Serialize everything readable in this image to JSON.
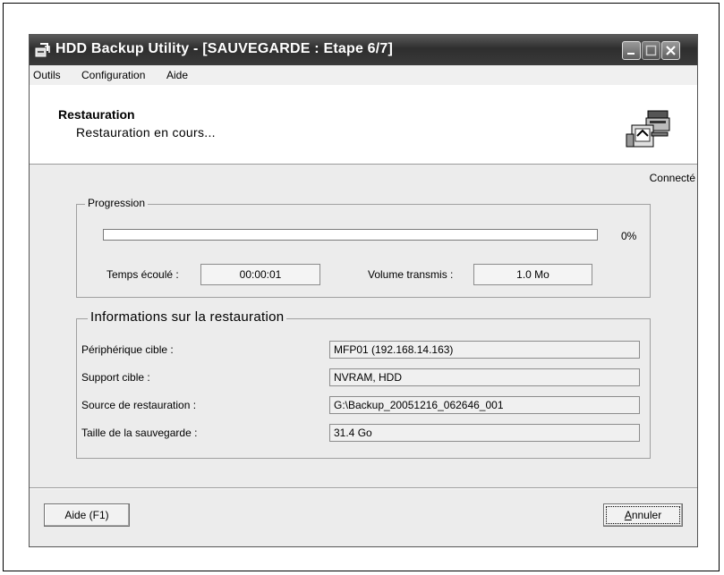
{
  "window": {
    "title": "HDD Backup Utility - [SAUVEGARDE : Etape 6/7]",
    "icon": "app-icon"
  },
  "menu": [
    "Outils",
    "Configuration",
    "Aide"
  ],
  "header": {
    "title": "Restauration",
    "subtitle": "Restauration en cours..."
  },
  "status": "Connecté",
  "progress": {
    "group_label": "Progression",
    "value_percent": 0,
    "percent_text": "0%",
    "elapsed_label": "Temps écoulé :",
    "elapsed_value": "00:00:01",
    "volume_label": "Volume transmis :",
    "volume_value": "1.0 Mo"
  },
  "info": {
    "group_label": "Informations sur la restauration",
    "rows": [
      {
        "label": "Périphérique cible :",
        "value": "MFP01  (192.168.14.163)"
      },
      {
        "label": "Support cible :",
        "value": "NVRAM, HDD"
      },
      {
        "label": "Source de restauration :",
        "value": "G:\\Backup_20051216_062646_001"
      },
      {
        "label": "Taille de la sauvegarde :",
        "value": "31.4 Go"
      }
    ]
  },
  "buttons": {
    "help": "Aide (F1)",
    "cancel_mnemonic": "A",
    "cancel_rest": "nnuler"
  }
}
